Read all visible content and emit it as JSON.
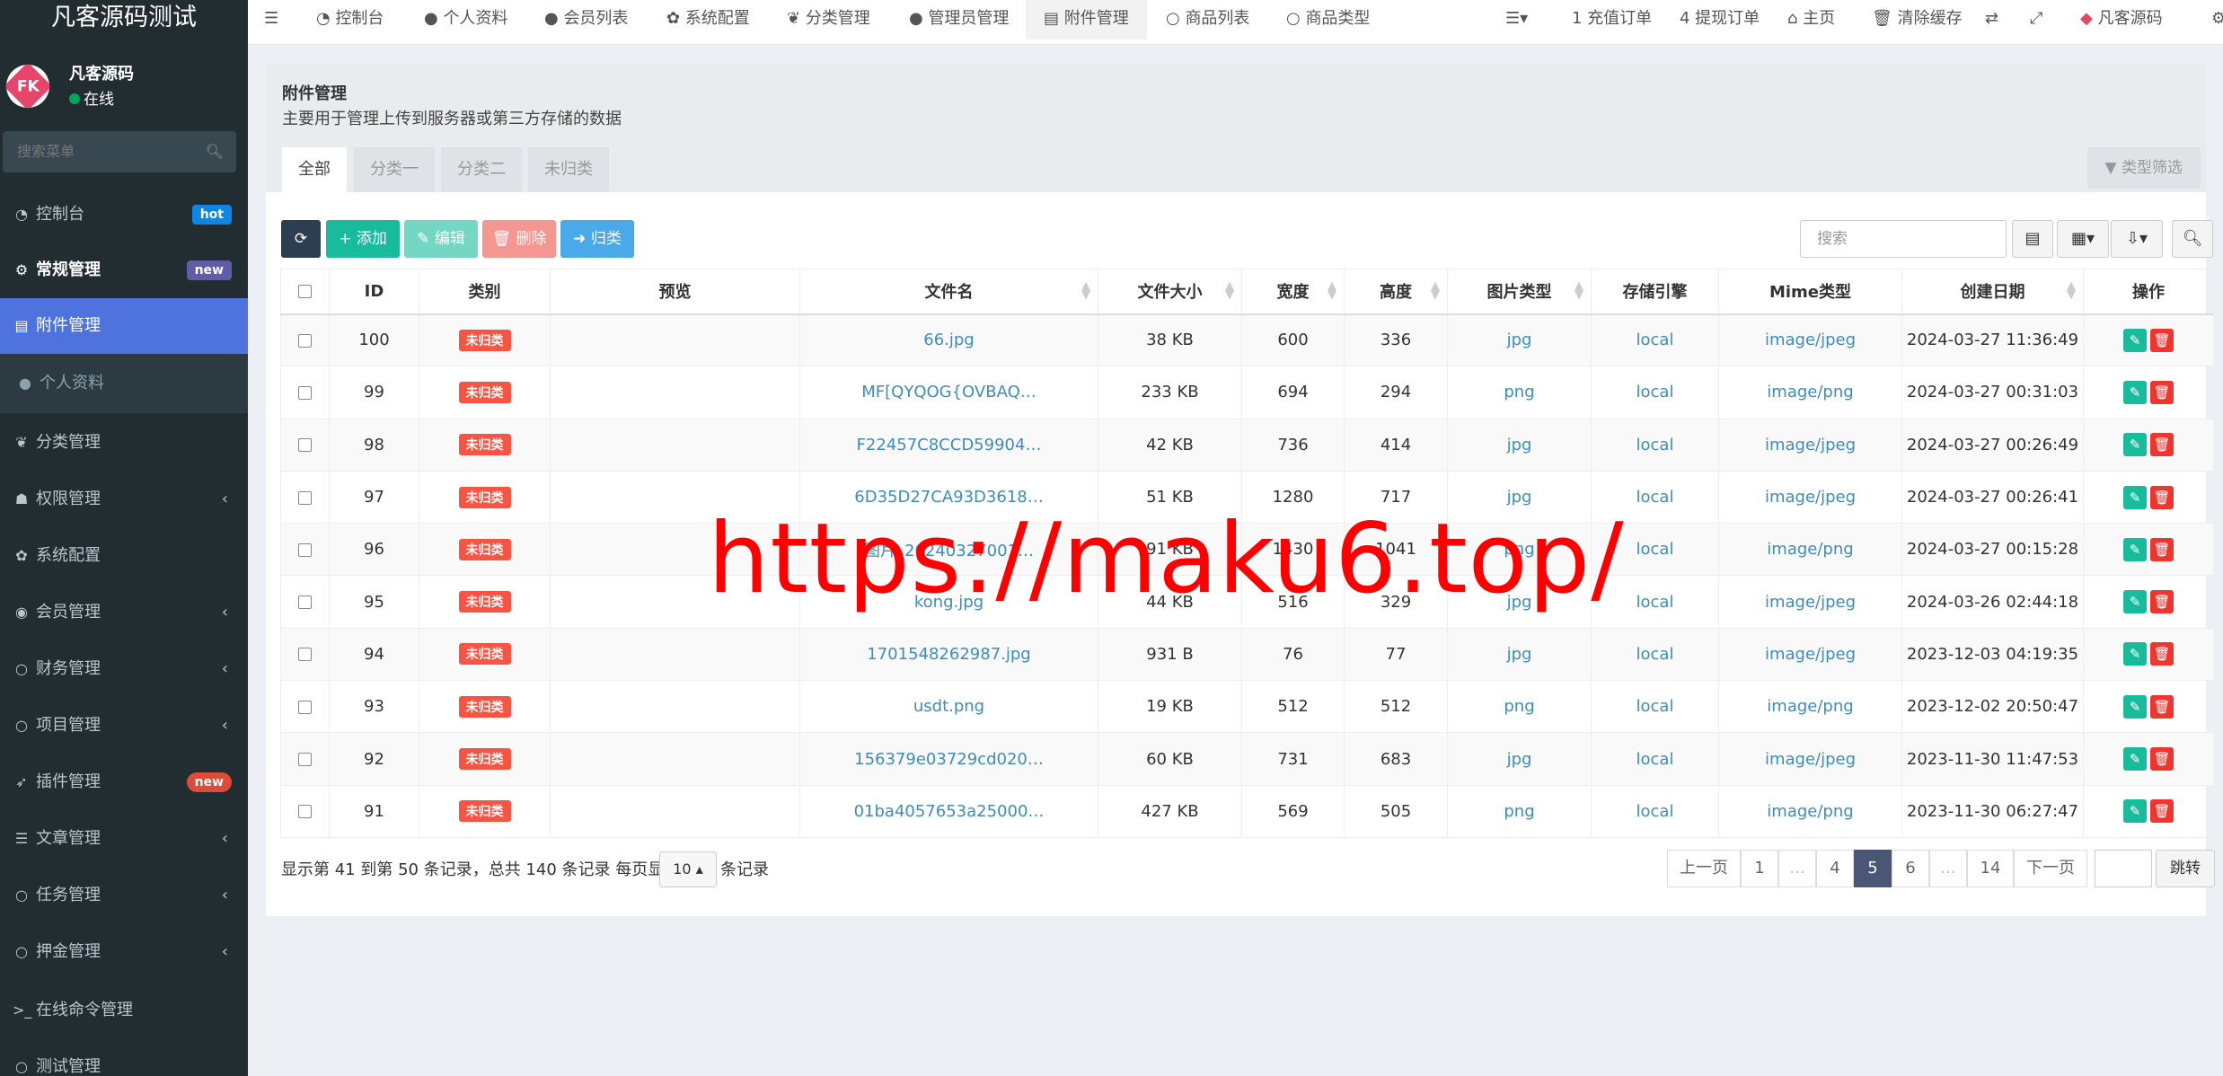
{
  "sidebar": {
    "logo": "凡客源码测试",
    "user_name": "凡客源码",
    "user_status": "在线",
    "search_placeholder": "搜索菜单",
    "items": [
      {
        "label": "控制台",
        "badge": "hot",
        "icon": "dashboard-icon"
      },
      {
        "label": "常规管理",
        "badge": "new",
        "icon": "cogs-icon"
      },
      {
        "label": "附件管理",
        "icon": "file-image-icon"
      },
      {
        "label": "个人资料",
        "icon": "user-icon"
      },
      {
        "label": "分类管理",
        "icon": "leaf-icon"
      },
      {
        "label": "权限管理",
        "icon": "group-icon"
      },
      {
        "label": "系统配置",
        "icon": "cog-icon"
      },
      {
        "label": "会员管理",
        "icon": "user-circle-icon"
      },
      {
        "label": "财务管理",
        "icon": "circle-o-icon"
      },
      {
        "label": "项目管理",
        "icon": "circle-o-icon"
      },
      {
        "label": "插件管理",
        "badge": "new",
        "icon": "rocket-icon"
      },
      {
        "label": "文章管理",
        "icon": "list-icon"
      },
      {
        "label": "任务管理",
        "icon": "circle-o-icon"
      },
      {
        "label": "押金管理",
        "icon": "circle-o-icon"
      },
      {
        "label": "在线命令管理",
        "icon": "terminal-icon"
      },
      {
        "label": "测试管理",
        "icon": "circle-o-icon"
      }
    ]
  },
  "topnav": {
    "tabs": [
      "控制台",
      "个人资料",
      "会员列表",
      "系统配置",
      "分类管理",
      "管理员管理",
      "附件管理",
      "商品列表",
      "商品类型"
    ],
    "recharge": "1 充值订单",
    "withdraw": "4 提现订单",
    "home": "主页",
    "clear_cache": "清除缓存",
    "user": "凡客源码"
  },
  "panel": {
    "title": "附件管理",
    "description": "主要用于管理上传到服务器或第三方存储的数据",
    "tabs": [
      "全部",
      "分类一",
      "分类二",
      "未归类"
    ],
    "filter_button": "类型筛选"
  },
  "toolbar": {
    "add": "添加",
    "edit": "编辑",
    "delete": "删除",
    "classify": "归类",
    "search_placeholder": "搜索"
  },
  "table": {
    "headers": [
      "ID",
      "类别",
      "预览",
      "文件名",
      "文件大小",
      "宽度",
      "高度",
      "图片类型",
      "存储引擎",
      "Mime类型",
      "创建日期",
      "操作"
    ],
    "rows": [
      {
        "id": "100",
        "category": "未归类",
        "filename": "66.jpg",
        "size": "38 KB",
        "width": "600",
        "height": "336",
        "type": "jpg",
        "storage": "local",
        "mime": "image/jpeg",
        "date": "2024-03-27 11:36:49"
      },
      {
        "id": "99",
        "category": "未归类",
        "filename": "MF[QYQOG{OVBAQ…",
        "size": "233 KB",
        "width": "694",
        "height": "294",
        "type": "png",
        "storage": "local",
        "mime": "image/png",
        "date": "2024-03-27 00:31:03"
      },
      {
        "id": "98",
        "category": "未归类",
        "filename": "F22457C8CCD59904…",
        "size": "42 KB",
        "width": "736",
        "height": "414",
        "type": "jpg",
        "storage": "local",
        "mime": "image/jpeg",
        "date": "2024-03-27 00:26:49"
      },
      {
        "id": "97",
        "category": "未归类",
        "filename": "6D35D27CA93D3618…",
        "size": "51 KB",
        "width": "1280",
        "height": "717",
        "type": "jpg",
        "storage": "local",
        "mime": "image/jpeg",
        "date": "2024-03-27 00:26:41"
      },
      {
        "id": "96",
        "category": "未归类",
        "filename": "图片_20240327001…",
        "size": "91 KB",
        "width": "1430",
        "height": "1041",
        "type": "png",
        "storage": "local",
        "mime": "image/png",
        "date": "2024-03-27 00:15:28"
      },
      {
        "id": "95",
        "category": "未归类",
        "filename": "kong.jpg",
        "size": "44 KB",
        "width": "516",
        "height": "329",
        "type": "jpg",
        "storage": "local",
        "mime": "image/jpeg",
        "date": "2024-03-26 02:44:18"
      },
      {
        "id": "94",
        "category": "未归类",
        "filename": "1701548262987.jpg",
        "size": "931 B",
        "width": "76",
        "height": "77",
        "type": "jpg",
        "storage": "local",
        "mime": "image/jpeg",
        "date": "2023-12-03 04:19:35"
      },
      {
        "id": "93",
        "category": "未归类",
        "filename": "usdt.png",
        "size": "19 KB",
        "width": "512",
        "height": "512",
        "type": "png",
        "storage": "local",
        "mime": "image/png",
        "date": "2023-12-02 20:50:47"
      },
      {
        "id": "92",
        "category": "未归类",
        "filename": "156379e03729cd020…",
        "size": "60 KB",
        "width": "731",
        "height": "683",
        "type": "jpg",
        "storage": "local",
        "mime": "image/jpeg",
        "date": "2023-11-30 11:47:53"
      },
      {
        "id": "91",
        "category": "未归类",
        "filename": "01ba4057653a25000…",
        "size": "427 KB",
        "width": "569",
        "height": "505",
        "type": "png",
        "storage": "local",
        "mime": "image/png",
        "date": "2023-11-30 06:27:47"
      }
    ]
  },
  "pagination": {
    "info": "显示第 41 到第 50 条记录，总共 140 条记录 每页显示",
    "page_size": "10",
    "unit": "条记录",
    "prev": "上一页",
    "next": "下一页",
    "pages": [
      "1",
      "...",
      "4",
      "5",
      "6",
      "...",
      "14"
    ],
    "current": "5",
    "jump": "跳转"
  },
  "watermark": "https://maku6.top/",
  "colors": {
    "sidebar_bg": "#222d32",
    "active_menu": "#4e73df",
    "add_button": "#18bc9c",
    "delete_button": "#f0352f",
    "classify_button": "#4aa9e9",
    "label_red": "#f75444",
    "link": "#3c8dbc"
  }
}
